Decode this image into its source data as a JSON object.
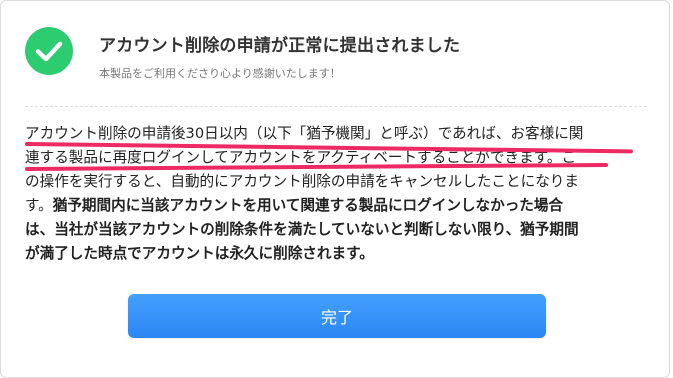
{
  "dialog": {
    "title": "アカウント削除の申請が正常に提出されました",
    "subtitle": "本製品をご利用くださり心より感謝いたします！",
    "body_lines": [
      "アカウント削除の申請後30日以内（以下「猶予機関」と呼ぶ）であれば、お客様に関",
      "連する製品に再度ログインしてアカウントをアクティベートすることができます。こ",
      "の操作を実行すると、自動的にアカウント削除の申請をキャンセルしたことになりま",
      "す。猶予期間内に当該アカウントを用いて関連する製品にログインしなかった場合",
      "は、当社が当該アカウントの削除条件を満たしていないと判断しない限り、猶予期間",
      "が満了した時点でアカウントは永久に削除されます。"
    ],
    "body_line3_normal": "す。",
    "body_line3_bold": "猶予期間内に当該アカウントを用いて関連する製品にログインしなかった場合",
    "done_label": "完了"
  },
  "colors": {
    "success_green": "#2ecc71",
    "annotation_red": "#ee2a65",
    "button_blue": "#3793f8"
  },
  "icons": {
    "status": "check-circle-icon"
  }
}
